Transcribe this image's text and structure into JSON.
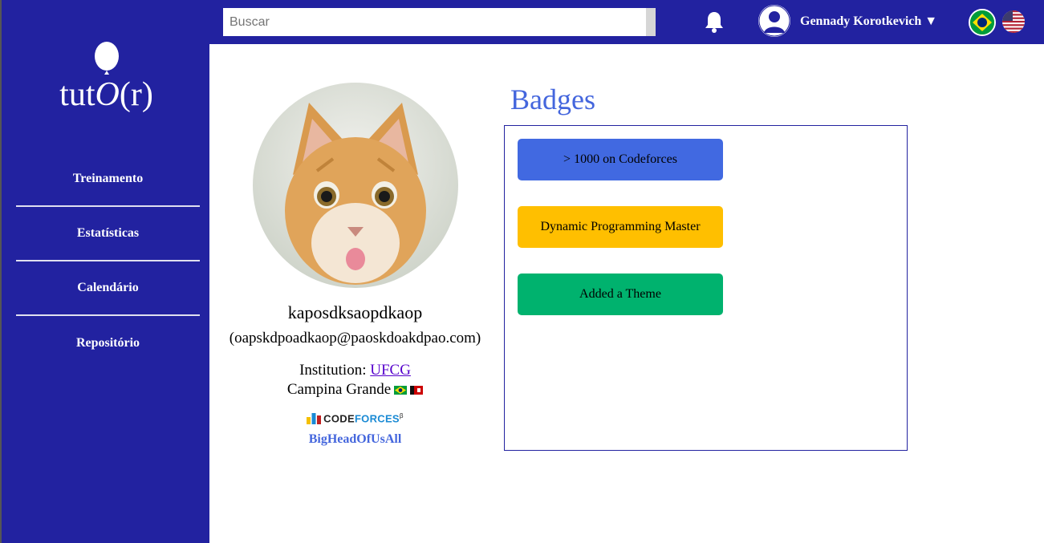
{
  "sidebar": {
    "logo_text": "tut",
    "logo_o": "O",
    "logo_r": "(r)",
    "items": [
      {
        "label": "Treinamento"
      },
      {
        "label": "Estatísticas"
      },
      {
        "label": "Calendário"
      },
      {
        "label": "Repositório"
      }
    ]
  },
  "header": {
    "search_placeholder": "Buscar",
    "user_name": "Gennady Korotkevich ▼",
    "icons": [
      "bell-icon",
      "user-avatar-icon",
      "brazil-flag-icon",
      "us-flag-icon"
    ]
  },
  "profile": {
    "name": "kaposdksaopdkaop",
    "email": "(oapskdpoadkaop@paoskdoakdpao.com)",
    "institution_label": "Institution: ",
    "institution": "UFCG",
    "city": "Campina Grande",
    "codeforces_logo_code": "CODE",
    "codeforces_logo_forces": "FORCES",
    "codeforces_logo_beta": "β",
    "codeforces_handle": "BigHeadOfUsAll"
  },
  "badges": {
    "title": "Badges",
    "items": [
      {
        "label": "> 1000 on Codeforces",
        "color": "#4169e1"
      },
      {
        "label": "Dynamic Programming Master",
        "color": "#ffbf00"
      },
      {
        "label": "Added a Theme",
        "color": "#00b26e"
      }
    ]
  },
  "colors": {
    "primary": "#2222a0",
    "accent": "#4466dd"
  }
}
